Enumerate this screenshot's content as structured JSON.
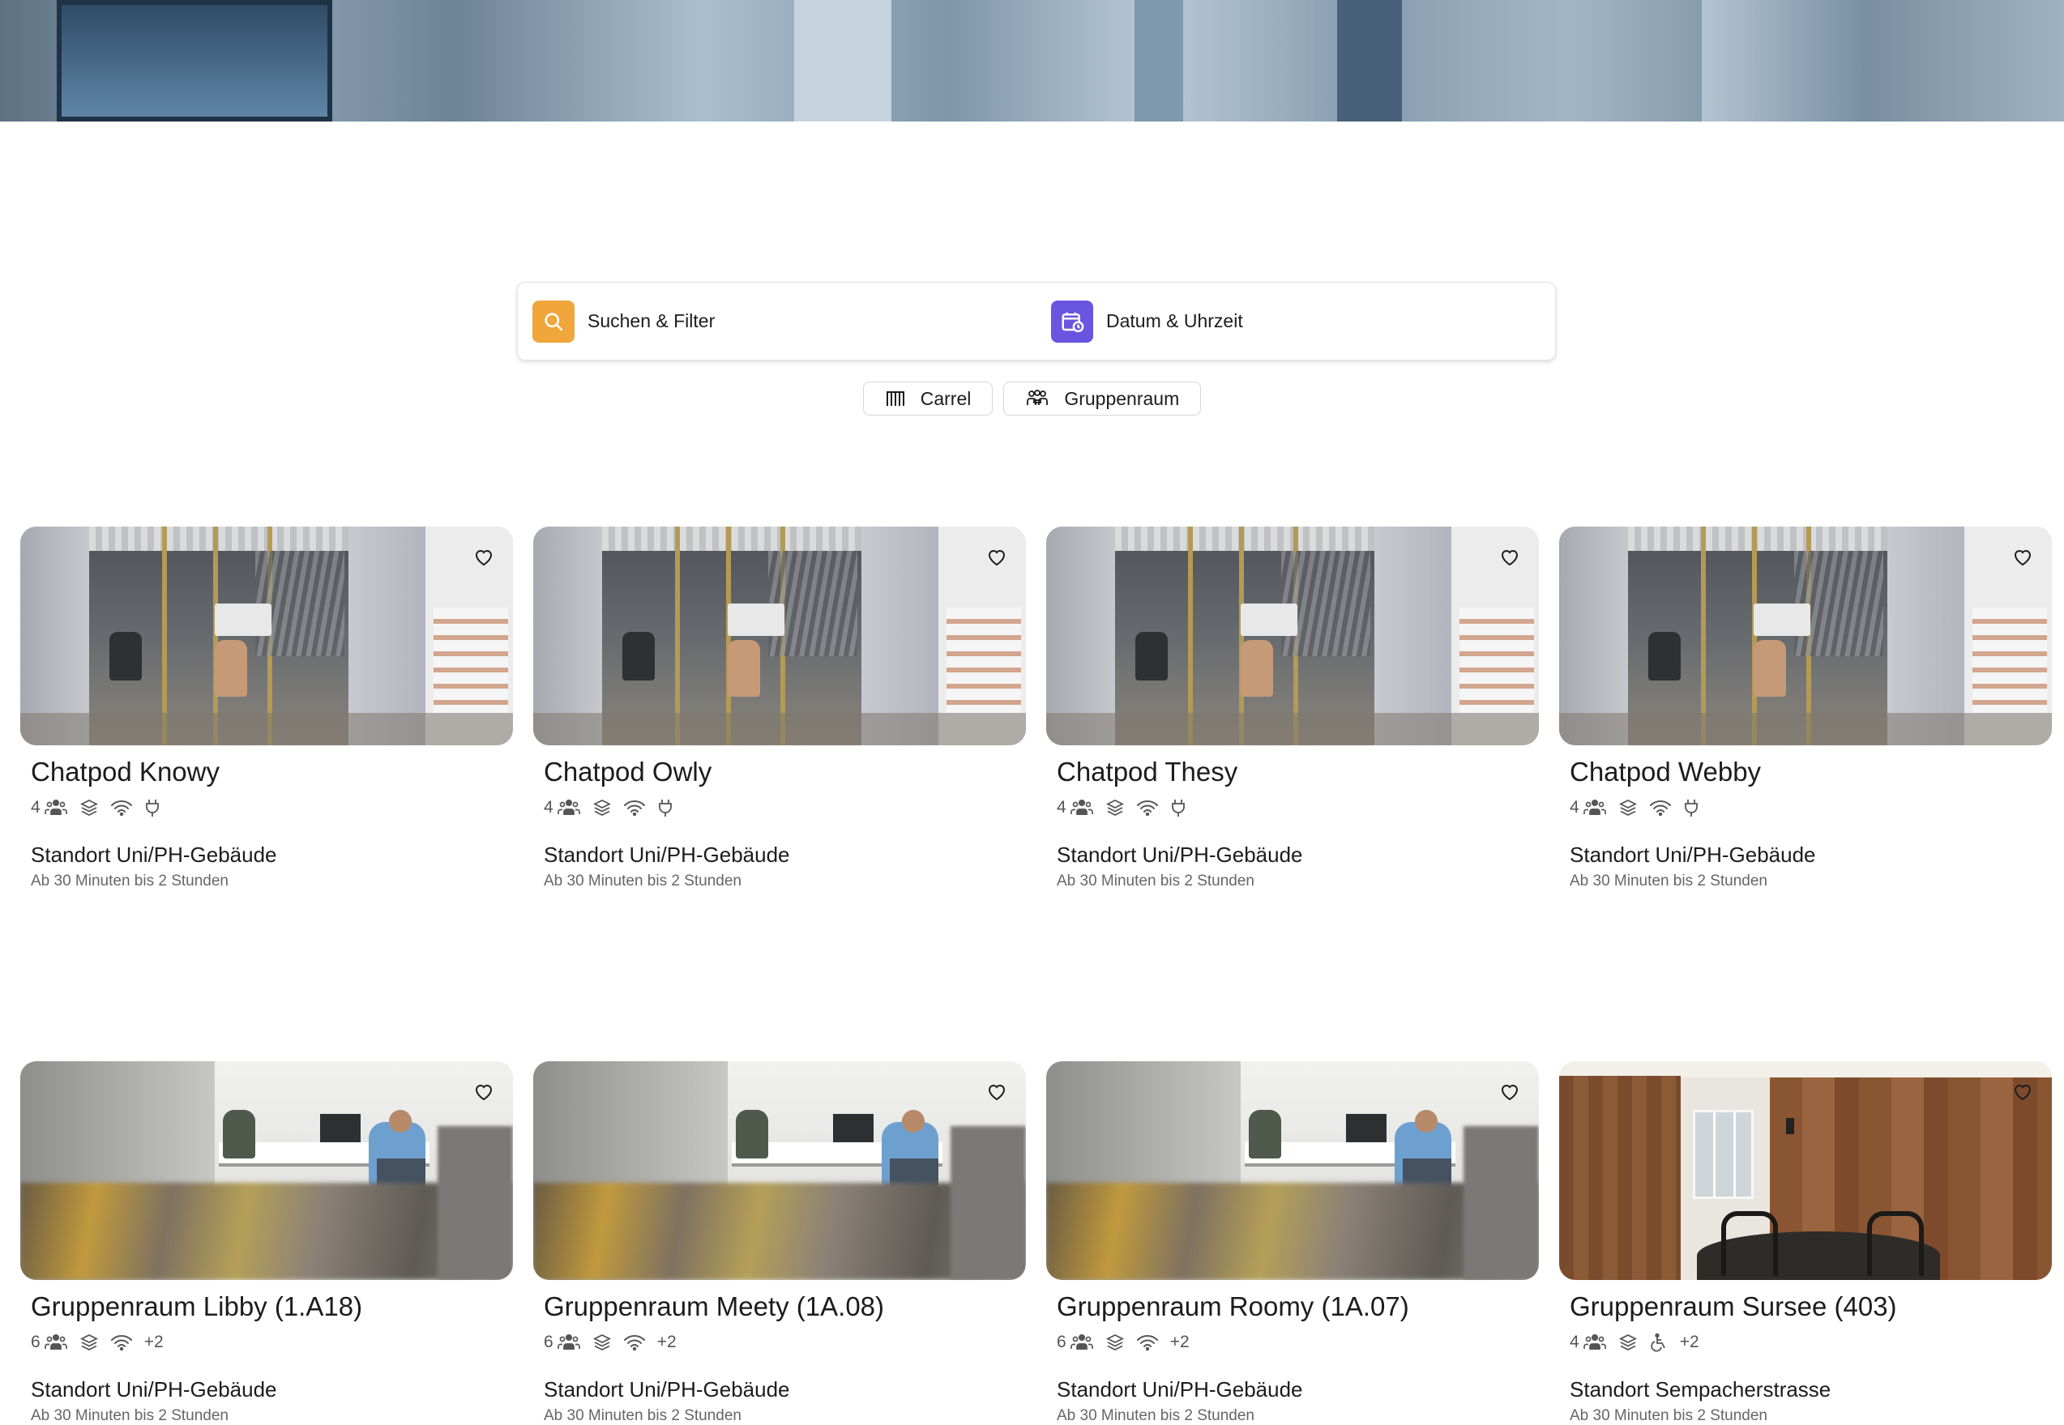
{
  "search": {
    "filter_label": "Suchen & Filter",
    "datetime_label": "Datum & Uhrzeit"
  },
  "chips": [
    {
      "label": "Carrel",
      "icon": "carrel-icon"
    },
    {
      "label": "Gruppenraum",
      "icon": "group-icon"
    }
  ],
  "rooms": [
    {
      "name": "Chatpod Knowy",
      "capacity": "4",
      "extra": "",
      "location": "Standort Uni/PH-Gebäude",
      "duration": "Ab 30 Minuten bis 2 Stunden",
      "image": "chatpod"
    },
    {
      "name": "Chatpod Owly",
      "capacity": "4",
      "extra": "",
      "location": "Standort Uni/PH-Gebäude",
      "duration": "Ab 30 Minuten bis 2 Stunden",
      "image": "chatpod"
    },
    {
      "name": "Chatpod Thesy",
      "capacity": "4",
      "extra": "",
      "location": "Standort Uni/PH-Gebäude",
      "duration": "Ab 30 Minuten bis 2 Stunden",
      "image": "chatpod"
    },
    {
      "name": "Chatpod Webby",
      "capacity": "4",
      "extra": "",
      "location": "Standort Uni/PH-Gebäude",
      "duration": "Ab 30 Minuten bis 2 Stunden",
      "image": "chatpod"
    },
    {
      "name": "Gruppenraum Libby (1.A18)",
      "capacity": "6",
      "extra": "+2",
      "location": "Standort Uni/PH-Gebäude",
      "duration": "Ab 30 Minuten bis 2 Stunden",
      "image": "library"
    },
    {
      "name": "Gruppenraum Meety (1A.08)",
      "capacity": "6",
      "extra": "+2",
      "location": "Standort Uni/PH-Gebäude",
      "duration": "Ab 30 Minuten bis 2 Stunden",
      "image": "library"
    },
    {
      "name": "Gruppenraum Roomy (1A.07)",
      "capacity": "6",
      "extra": "+2",
      "location": "Standort Uni/PH-Gebäude",
      "duration": "Ab 30 Minuten bis 2 Stunden",
      "image": "library"
    },
    {
      "name": "Gruppenraum Sursee (403)",
      "capacity": "4",
      "extra": "+2",
      "location": "Standort Sempacherstrasse",
      "duration": "Ab 30 Minuten bis 2 Stunden",
      "image": "wood"
    }
  ],
  "colors": {
    "filter_icon_bg": "#f0a63a",
    "datetime_icon_bg": "#6a55e0"
  }
}
